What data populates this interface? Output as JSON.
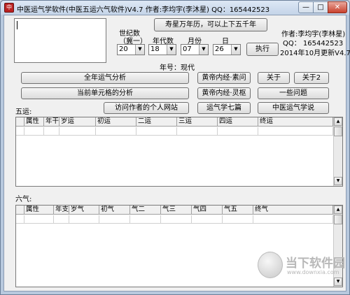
{
  "window": {
    "title": "中医运气学软件(中医五运六气软件)V4.7  作者:李均宇(李沐星) QQ：165442523",
    "icon_glyph": "中",
    "min_glyph": "—",
    "max_glyph": "□",
    "close_glyph": "✕"
  },
  "form": {
    "era_label_1": "世纪数",
    "era_label_2": "（冀一）",
    "decade_label": "年代数",
    "month_label": "月份",
    "day_label": "日",
    "century_value": "20",
    "decade_value": "18",
    "month_value": "07",
    "day_value": "26",
    "calendar_button": "寿星万年历，可以上下五千年",
    "execute_button": "执行",
    "year_name": "年号：现代"
  },
  "author": {
    "line1": "作者:李均宇(李林星)",
    "line2": "QQ： 165442523",
    "line3": "2014年10月更新V4.7"
  },
  "buttons": {
    "year_analysis": "全年运气分析",
    "current_unit": "当前单元格的分析",
    "visit_site": "访问作者的个人网站",
    "suwen": "黄帝内经·素问",
    "lingshu": "黄帝内经·灵枢",
    "seven_chapters": "运气学七篇",
    "about": "关于",
    "about2": "关于2",
    "questions": "一些问题",
    "tcm_theory": "中医运气学说"
  },
  "wuyun": {
    "label": "五运:",
    "columns": [
      "属性",
      "年干",
      "岁运",
      "初运",
      "二运",
      "三运",
      "四运",
      "终运"
    ]
  },
  "liuqi": {
    "label": "六气:",
    "columns": [
      "属性",
      "年支",
      "岁气",
      "初气",
      "气二",
      "气三",
      "气四",
      "气五",
      "终气"
    ]
  },
  "watermark": {
    "brand": "当下软件园",
    "url": "www.downxia.com"
  },
  "colors": {
    "window_frame": "#b8c9de",
    "client_bg": "#f0f0f0",
    "close_button": "#c9412d"
  }
}
